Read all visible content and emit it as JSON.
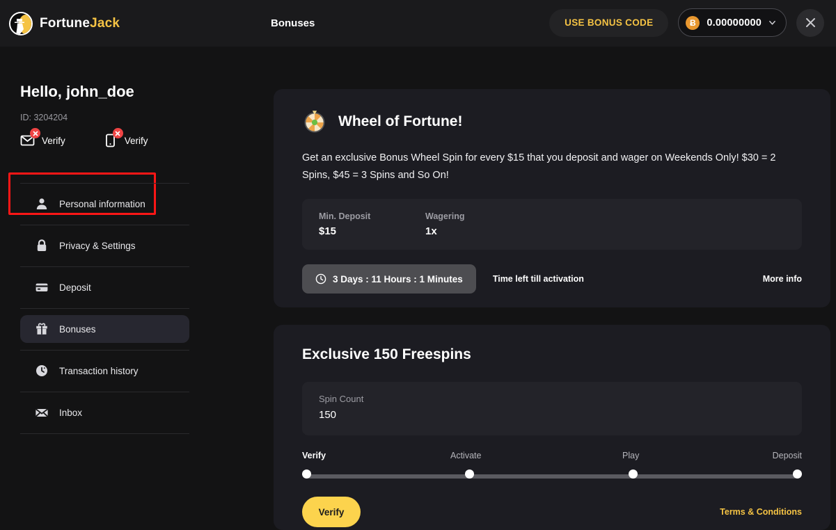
{
  "topbar": {
    "brand_first": "Fortune",
    "brand_second": "Jack",
    "logo_icon": "fortunejack-logo-icon",
    "page_title": "Bonuses",
    "bonus_code_label": "USE BONUS CODE",
    "balance_value": "0.00000000",
    "balance_currency_icon": "bitcoin-icon",
    "balance_symbol": "Ƀ",
    "chevron_icon": "chevron-down-icon",
    "close_icon": "close-icon"
  },
  "sidebar": {
    "greeting": "Hello, john_doe",
    "user_id": "ID: 3204204",
    "verify_items": [
      {
        "label": "Verify",
        "icon": "email-icon",
        "badge": "error-badge-icon"
      },
      {
        "label": "Verify",
        "icon": "phone-icon",
        "badge": "error-badge-icon"
      }
    ],
    "nav": [
      {
        "label": "Personal information",
        "icon": "user-icon",
        "active": false
      },
      {
        "label": "Privacy & Settings",
        "icon": "lock-icon",
        "active": false
      },
      {
        "label": "Deposit",
        "icon": "card-icon",
        "active": false
      },
      {
        "label": "Bonuses",
        "icon": "gift-icon",
        "active": true
      },
      {
        "label": "Transaction history",
        "icon": "history-icon",
        "active": false
      },
      {
        "label": "Inbox",
        "icon": "envelope-icon",
        "active": false
      }
    ]
  },
  "wheel_card": {
    "icon": "wheel-of-fortune-icon",
    "title": "Wheel of Fortune!",
    "description": "Get an exclusive Bonus Wheel Spin for every $15 that you deposit and wager on Weekends Only! $30 = 2 Spins, $45 = 3 Spins and So On!",
    "stats": [
      {
        "key": "Min. Deposit",
        "value": "$15"
      },
      {
        "key": "Wagering",
        "value": "1x"
      }
    ],
    "timer_icon": "clock-icon",
    "timer_value": "3 Days : 11 Hours : 1 Minutes",
    "timer_note": "Time left till activation",
    "more_info_label": "More info"
  },
  "freespins_card": {
    "title": "Exclusive 150 Freespins",
    "spin_count_label": "Spin Count",
    "spin_count_value": "150",
    "steps": [
      {
        "label": "Verify",
        "state": "done"
      },
      {
        "label": "Activate",
        "state": "todo"
      },
      {
        "label": "Play",
        "state": "todo"
      },
      {
        "label": "Deposit",
        "state": "todo"
      }
    ],
    "verify_button": "Verify",
    "terms_label": "Terms & Conditions"
  },
  "colors": {
    "accent_yellow": "#f5c344",
    "button_yellow": "#fcd34d",
    "page_bg": "#131314",
    "card_bg": "#1c1c22",
    "panel_bg": "#232329",
    "error_red": "#ef4444",
    "highlight_red": "#ff1616",
    "bitcoin_orange": "#e8972f"
  }
}
